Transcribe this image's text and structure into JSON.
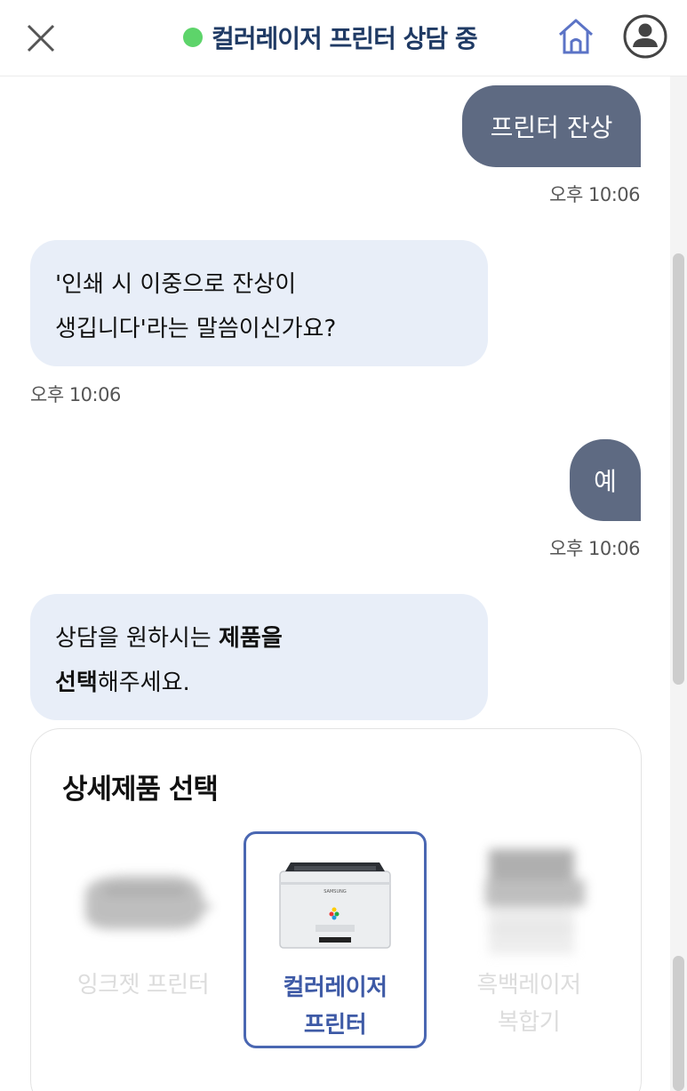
{
  "header": {
    "title": "컬러레이저 프린터 상담 중",
    "status_color": "#5dd46a",
    "icons": [
      "close-icon",
      "home-icon",
      "user-icon"
    ]
  },
  "messages": [
    {
      "sender": "user",
      "text": "프린터 잔상",
      "time": "오후 10:06"
    },
    {
      "sender": "bot",
      "line1": "'인쇄 시 이중으로 잔상이",
      "line2": "생깁니다'라는 말씀이신가요?",
      "time": "오후 10:06"
    },
    {
      "sender": "user",
      "text": "예",
      "time": "오후 10:06"
    },
    {
      "sender": "bot",
      "line1_a": "상담을 원하시는 ",
      "line1_b": "제품을",
      "line2_a": "선택",
      "line2_b": "해주세요."
    }
  ],
  "product_card": {
    "title": "상세제품 선택",
    "products": [
      {
        "label": "잉크젯 프린터",
        "selected": false
      },
      {
        "label": "컬러레이저\n프린터",
        "selected": true
      },
      {
        "label": "흑백레이저\n복합기",
        "selected": false
      }
    ]
  },
  "colors": {
    "user_bubble": "#5e6a82",
    "bot_bubble": "#e8eef8",
    "accent": "#4a67b2",
    "title": "#1f3a64"
  }
}
